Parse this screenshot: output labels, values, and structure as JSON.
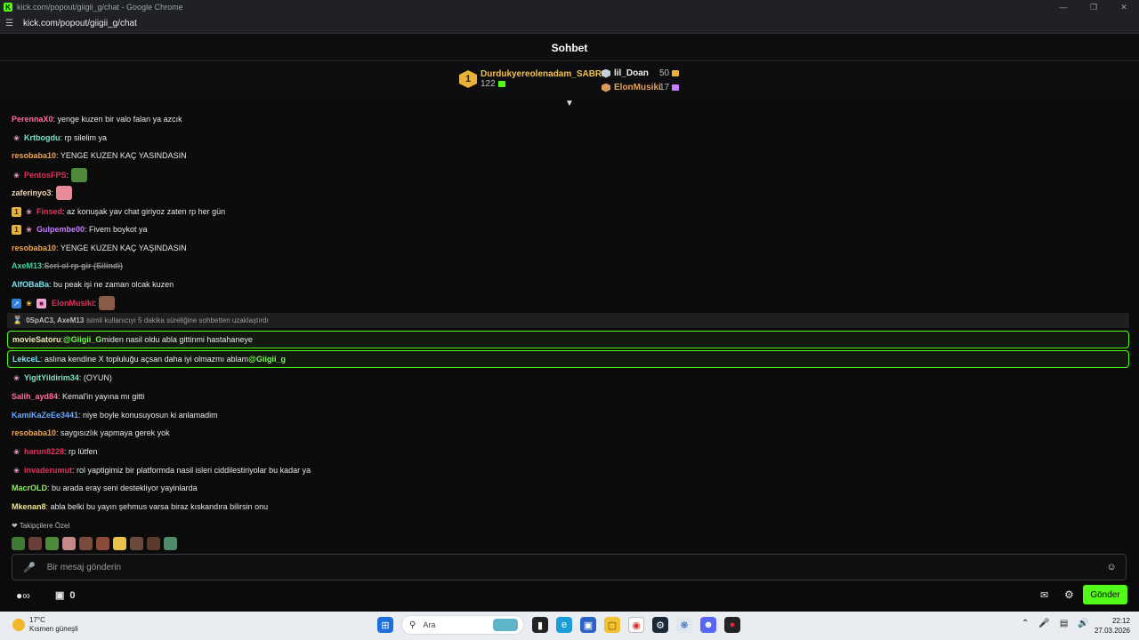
{
  "window": {
    "title": "kick.com/popout/giigii_g/chat - Google Chrome",
    "url": "kick.com/popout/giigii_g/chat"
  },
  "chat": {
    "title": "Sohbet"
  },
  "leaderboard": {
    "first": {
      "rank": "1",
      "name": "Durdukyereolenadam_SABRI",
      "points": "122"
    },
    "others": [
      {
        "name": "lil_Doan",
        "points": "50",
        "medal_color": "#c9d1d9"
      },
      {
        "name": "ElonMusiki",
        "points": "17",
        "medal_color": "#d99a5a"
      }
    ]
  },
  "messages": [
    {
      "user": "PerennaX0",
      "color": "#ff6ba0",
      "text": ": yenge kuzen bir valo falan ya azcık"
    },
    {
      "user": "Krtbogdu",
      "color": "#7ee0c8",
      "text": ": rp silelim ya"
    },
    {
      "user": "resobaba10",
      "color": "#f5a44a",
      "text": ": YENGE KUZEN KAÇ YASINDASIN"
    },
    {
      "user": "PentosFPS",
      "color": "#e0325a",
      "text": ":"
    },
    {
      "user": "zaferinyo3",
      "color": "#f2d6b3",
      "text": ":"
    },
    {
      "user": "Finsed",
      "color": "#e0325a",
      "text": ": az konuşak yav chat giriyoz zaten rp her gün"
    },
    {
      "user": "Gulpembe00",
      "color": "#c77dff",
      "text": ": Fivem boykot ya"
    },
    {
      "user": "resobaba10",
      "color": "#f5a44a",
      "text": ": YENGE KUZEN KAÇ YAŞINDASIN"
    },
    {
      "user": "AxeM13",
      "color": "#3fd0a0",
      "text": ": ",
      "deleted": "Seri ol rp gir (Silindi)"
    },
    {
      "user": "AlfOBaBa",
      "color": "#7ee0f2",
      "text": ": bu peak işi ne zaman olcak kuzen"
    },
    {
      "user": "ElonMusiki",
      "color": "#e0325a",
      "text": ":"
    },
    {
      "user": "YigitYildirim34",
      "color": "#7ee0c8",
      "text": ": (OYUN)"
    },
    {
      "user": "Salih_ayd84",
      "color": "#ff6ba0",
      "text": ": Kemal'in yayına mı gitti"
    },
    {
      "user": "KamiKaZeEe3441",
      "color": "#6aa8ff",
      "text": ": niye boyle konusuyosun ki anlamadim"
    },
    {
      "user": "resobaba10",
      "color": "#f5a44a",
      "text": ": saygısızlık yapmaya gerek yok"
    },
    {
      "user": "harun8228",
      "color": "#e0325a",
      "text": ": rp lütfen"
    },
    {
      "user": "invaderumut",
      "color": "#e0325a",
      "text": ": rol yaptigimiz bir platformda nasil isleri ciddilestiriyolar bu kadar ya"
    },
    {
      "user": "MacrOLD",
      "color": "#8cf05a",
      "text": ": bu arada eray seni destekliyor yayinlarda"
    },
    {
      "user": "Mkenan8",
      "color": "#f2e38a",
      "text": ": abla belki bu yayın şehmus varsa biraz kıskandıra bilirsin onu"
    }
  ],
  "system": {
    "names": "0SpAC3, AxeM13",
    "text": "isimli kullanıcıyı 5 dakika süreliğine sohbetten uzaklaştırdı"
  },
  "mentions": [
    {
      "user": "movieSatoru",
      "color": "#f2e6c0",
      "text_before": ": ",
      "mention": "@Giigii_G",
      "text_after": " miden nasil oldu abla gittinmi hastahaneye"
    },
    {
      "user": "LekceL",
      "color": "#7ee0f2",
      "text_before": ": aslına kendine X topluluğu açsan daha iyi olmazmı ablam ",
      "mention": "@Giigii_g",
      "text_after": ""
    }
  ],
  "footer": {
    "followers_label": "Takipçilere Özel",
    "input_placeholder": "Bir mesaj gönderin",
    "points_count": "0",
    "send_label": "Gönder"
  },
  "taskbar": {
    "weather_temp": "17°C",
    "weather_desc": "Kısmen güneşli",
    "search_placeholder": "Ara",
    "time": "22:12",
    "date": "27.03.2026"
  },
  "colors": {
    "accent": "#53fc18",
    "background": "#0b0b0c"
  }
}
